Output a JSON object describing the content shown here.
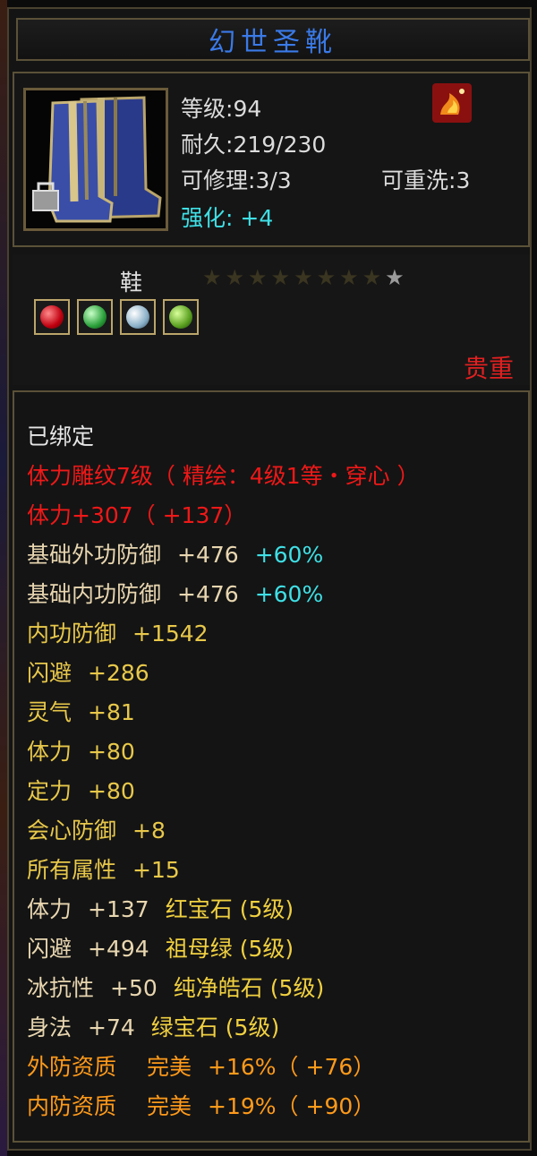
{
  "item": {
    "name": "幻世圣靴",
    "level_label": "等级:",
    "level": "94",
    "durability_label": "耐久:",
    "durability": "219/230",
    "repair_label": "可修理:",
    "repair": "3/3",
    "rewash_label": "可重洗:",
    "rewash": "3",
    "enhance_label": "强化:",
    "enhance": "+4",
    "type": "鞋",
    "stars_total": 8,
    "stars_lit": 1,
    "rarity": "贵重"
  },
  "gem_icons": [
    "ruby-gem-icon",
    "emerald-gem-icon",
    "diamond-gem-icon",
    "green-gem-icon"
  ],
  "attributes": {
    "bound": "已绑定",
    "engrave": "体力雕纹7级（ 精绘：4级1等・穿心 ）",
    "engrave_stat": "体力+307（ +137）",
    "base_outer_def": {
      "name": "基础外功防御",
      "value": "+476",
      "bonus": "+60%"
    },
    "base_inner_def": {
      "name": "基础内功防御",
      "value": "+476",
      "bonus": "+60%"
    },
    "inner_def": {
      "name": "内功防御",
      "value": "+1542"
    },
    "dodge": {
      "name": "闪避",
      "value": "+286"
    },
    "spirit": {
      "name": "灵气",
      "value": "+81"
    },
    "stamina": {
      "name": "体力",
      "value": "+80"
    },
    "focus": {
      "name": "定力",
      "value": "+80"
    },
    "crit_def": {
      "name": "会心防御",
      "value": "+8"
    },
    "all_attr": {
      "name": "所有属性",
      "value": "+15"
    },
    "gem_lines": [
      {
        "stat": "体力",
        "value": "+137",
        "gem": "红宝石",
        "grade": "(5级)"
      },
      {
        "stat": "闪避",
        "value": "+494",
        "gem": "祖母绿",
        "grade": "(5级)"
      },
      {
        "stat": "冰抗性",
        "value": "+50",
        "gem": "纯净皓石",
        "grade": "(5级)"
      },
      {
        "stat": "身法",
        "value": "+74",
        "gem": "绿宝石",
        "grade": "(5级)"
      }
    ],
    "quality_lines": [
      {
        "name": "外防资质",
        "grade": "完美",
        "value": "+16%（ +76）"
      },
      {
        "name": "内防资质",
        "grade": "完美",
        "value": "+19%（ +90）"
      }
    ]
  },
  "colors": {
    "title": "#3a7ae8",
    "engrave": "#f01818",
    "bonus": "#3fe0e6",
    "quality": "#ff9a1a",
    "stat": "#e8c84a"
  }
}
